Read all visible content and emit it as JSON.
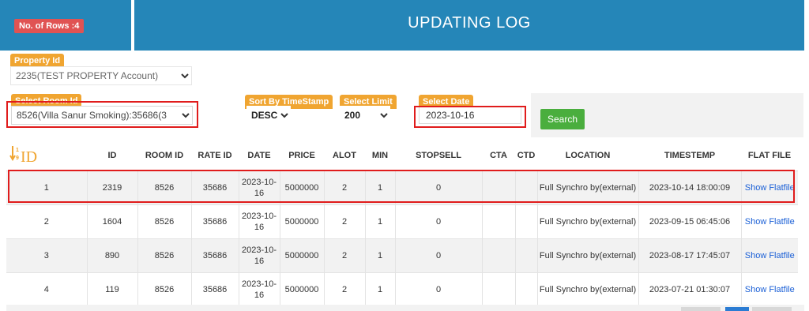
{
  "header": {
    "rows_badge": "No. of Rows :4",
    "title": "UPDATING LOG"
  },
  "filters": {
    "property": {
      "label": "Property Id",
      "value": "2235(TEST PROPERTY Account)"
    },
    "room": {
      "label": "Select Room Id",
      "value": "8526(Villa Sanur Smoking):35686(3"
    },
    "sort": {
      "label": "Sort By TimeStamp",
      "value": "DESC"
    },
    "limit": {
      "label": "Select Limit",
      "value": "200"
    },
    "date": {
      "label": "Select Date",
      "value": "2023-10-16"
    },
    "search_label": "Search"
  },
  "table": {
    "sort_header": "ID",
    "columns": [
      "ID",
      "ROOM ID",
      "RATE ID",
      "DATE",
      "PRICE",
      "ALOT",
      "MIN",
      "STOPSELL",
      "CTA",
      "CTD",
      "LOCATION",
      "TIMESTEMP",
      "FLAT FILE"
    ],
    "rows": [
      {
        "no": "1",
        "id": "2319",
        "room_id": "8526",
        "rate_id": "35686",
        "date": "2023-10-16",
        "price": "5000000",
        "alot": "2",
        "min": "1",
        "stopsell": "0",
        "cta": "",
        "ctd": "",
        "location": "Full Synchro by(external)",
        "timestamp": "2023-10-14 18:00:09",
        "flat_file": "Show Flatfile"
      },
      {
        "no": "2",
        "id": "1604",
        "room_id": "8526",
        "rate_id": "35686",
        "date": "2023-10-16",
        "price": "5000000",
        "alot": "2",
        "min": "1",
        "stopsell": "0",
        "cta": "",
        "ctd": "",
        "location": "Full Synchro by(external)",
        "timestamp": "2023-09-15 06:45:06",
        "flat_file": "Show Flatfile"
      },
      {
        "no": "3",
        "id": "890",
        "room_id": "8526",
        "rate_id": "35686",
        "date": "2023-10-16",
        "price": "5000000",
        "alot": "2",
        "min": "1",
        "stopsell": "0",
        "cta": "",
        "ctd": "",
        "location": "Full Synchro by(external)",
        "timestamp": "2023-08-17 17:45:07",
        "flat_file": "Show Flatfile"
      },
      {
        "no": "4",
        "id": "119",
        "room_id": "8526",
        "rate_id": "35686",
        "date": "2023-10-16",
        "price": "5000000",
        "alot": "2",
        "min": "1",
        "stopsell": "0",
        "cta": "",
        "ctd": "",
        "location": "Full Synchro by(external)",
        "timestamp": "2023-07-21 01:30:07",
        "flat_file": "Show Flatfile"
      }
    ]
  },
  "colors": {
    "header_blue": "#2586b8",
    "badge_red": "#e05353",
    "tag_orange": "#f0a531",
    "search_green": "#4aae3e",
    "highlight_red": "#e01c1c",
    "link_blue": "#1a5fd6"
  }
}
